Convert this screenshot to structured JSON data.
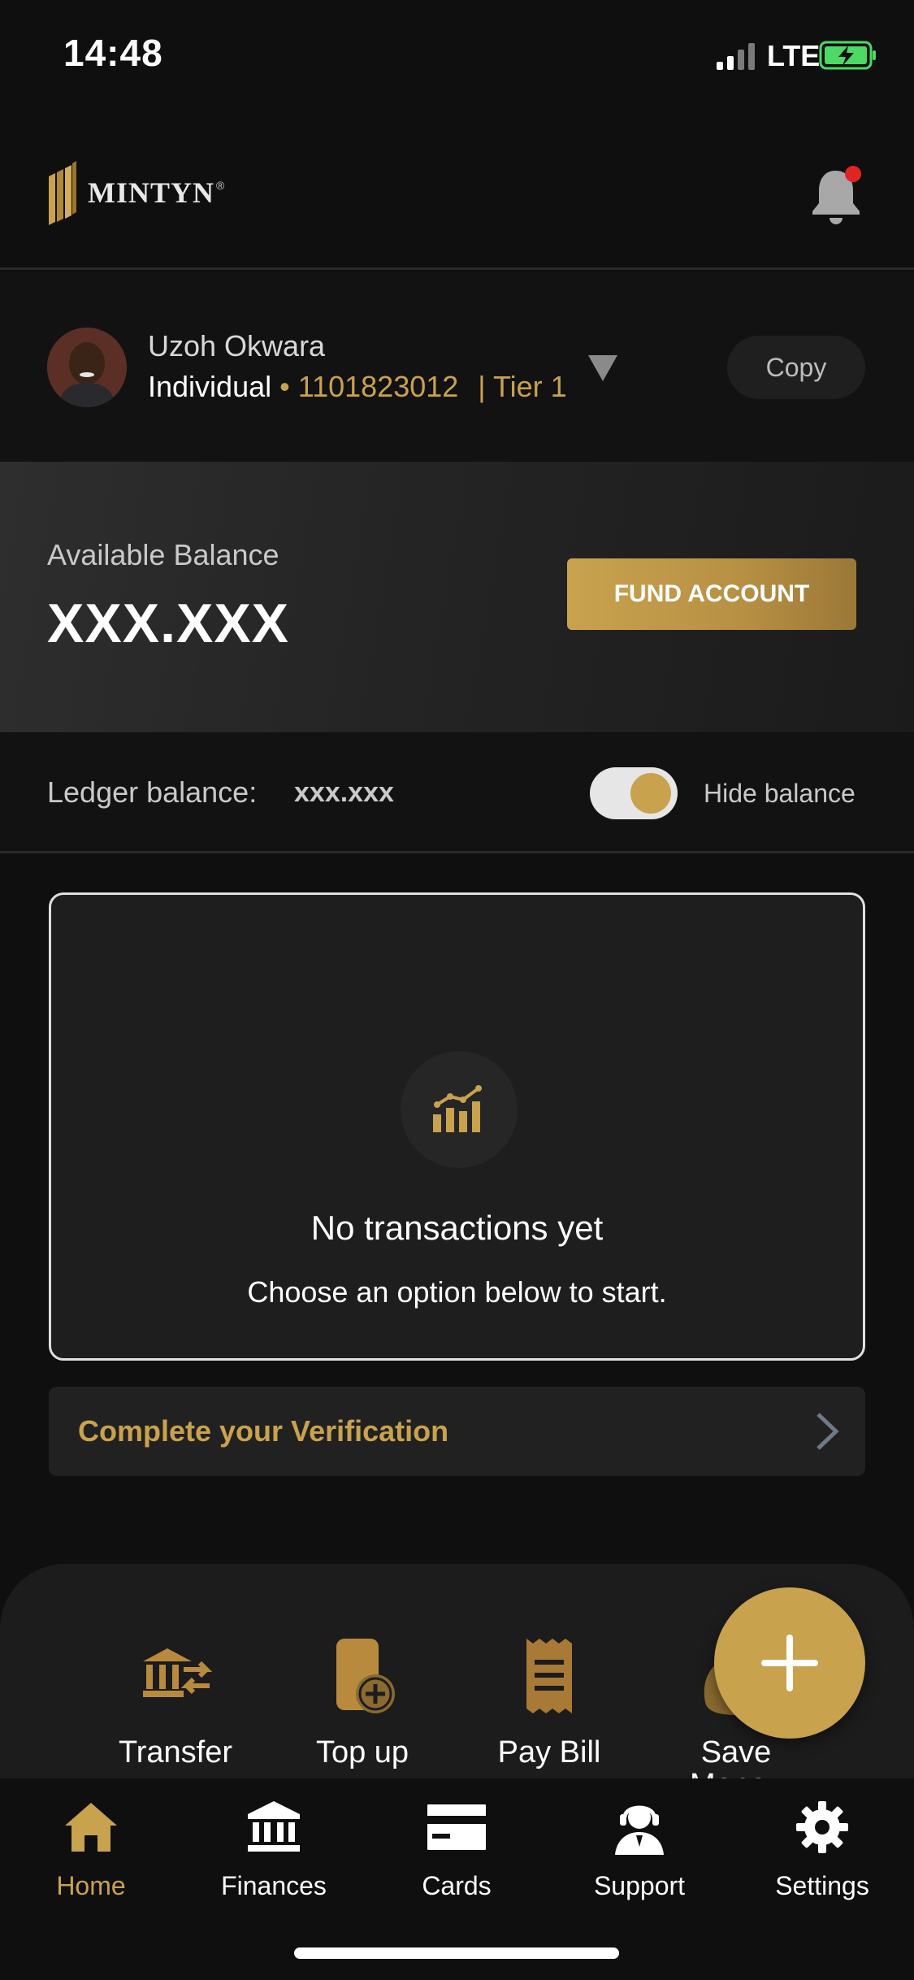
{
  "status_bar": {
    "time": "14:48",
    "network": "LTE"
  },
  "header": {
    "brand": "MINTYN",
    "brand_mark": "®"
  },
  "account": {
    "name": "Uzoh Okwara",
    "type": "Individual",
    "number": "• 1101823012",
    "tier": "| Tier 1",
    "copy_label": "Copy"
  },
  "balance": {
    "label": "Available Balance",
    "value": "XXX.XXX",
    "fund_label": "FUND ACCOUNT"
  },
  "ledger": {
    "label": "Ledger balance:",
    "value": "xxx.xxx",
    "hide_label": "Hide balance",
    "hide_enabled": true
  },
  "transactions": {
    "empty_title": "No transactions yet",
    "empty_subtitle": "Choose an option below to start."
  },
  "verification": {
    "label": "Complete your Verification"
  },
  "quick_actions": [
    {
      "label": "Transfer",
      "icon": "bank-transfer-icon"
    },
    {
      "label": "Top up",
      "icon": "phone-topup-icon"
    },
    {
      "label": "Pay Bill",
      "icon": "receipt-icon"
    },
    {
      "label": "Save Money",
      "icon": "money-bag-icon"
    }
  ],
  "tabs": [
    {
      "label": "Home",
      "icon": "home-icon",
      "active": true
    },
    {
      "label": "Finances",
      "icon": "bank-icon",
      "active": false
    },
    {
      "label": "Cards",
      "icon": "card-icon",
      "active": false
    },
    {
      "label": "Support",
      "icon": "headset-icon",
      "active": false
    },
    {
      "label": "Settings",
      "icon": "gear-icon",
      "active": false
    }
  ],
  "colors": {
    "accent": "#c9a24e",
    "background": "#0f0f0f",
    "notification_dot": "#e02424"
  }
}
